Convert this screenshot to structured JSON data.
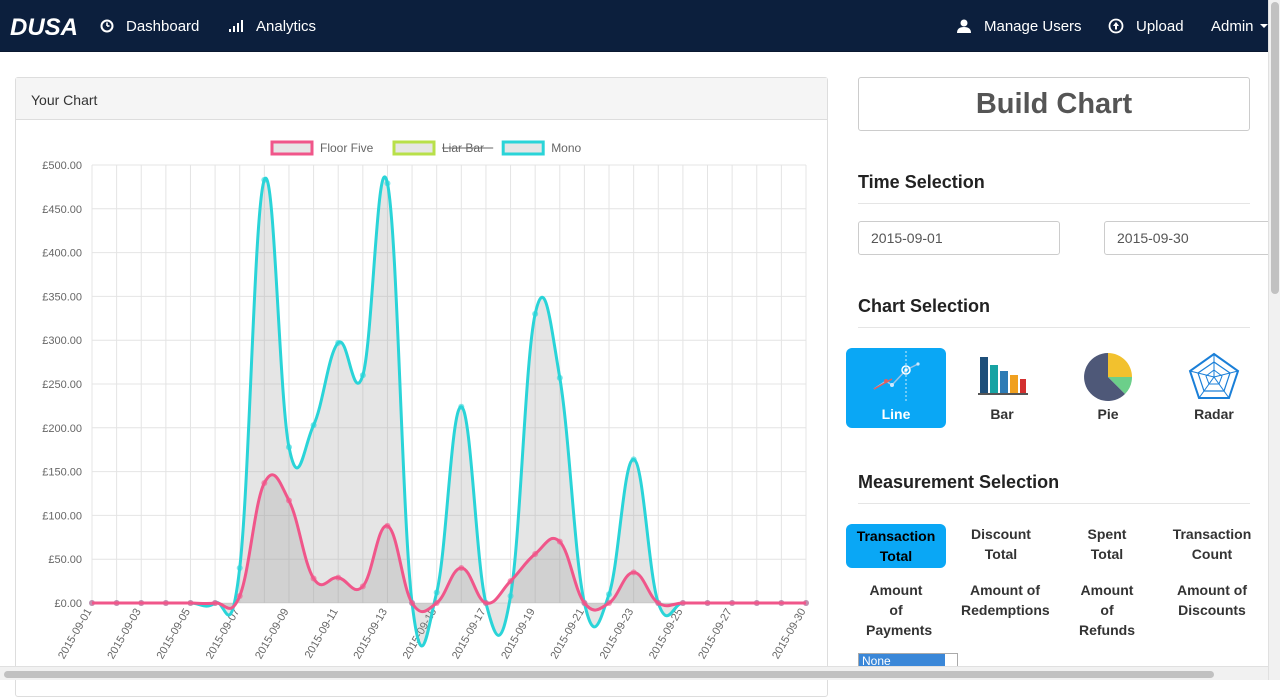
{
  "navbar": {
    "brand": "DUSA",
    "dashboard_label": "Dashboard",
    "analytics_label": "Analytics",
    "manage_users_label": "Manage Users",
    "upload_label": "Upload",
    "admin_label": "Admin",
    "bg_color": "#0c1f3d"
  },
  "panel": {
    "title": "Your Chart"
  },
  "sidebar": {
    "build_button": "Build Chart",
    "time_title": "Time Selection",
    "start_date": "2015-09-01",
    "end_date": "2015-09-30",
    "chart_title": "Chart Selection",
    "chart_types": [
      {
        "label": "Line",
        "icon": "line-chart-icon",
        "active": true
      },
      {
        "label": "Bar",
        "icon": "bar-chart-icon",
        "active": false
      },
      {
        "label": "Pie",
        "icon": "pie-chart-icon",
        "active": false
      },
      {
        "label": "Radar",
        "icon": "radar-chart-icon",
        "active": false
      }
    ],
    "measure_title": "Measurement Selection",
    "measures": {
      "transaction_total": "Transaction Total",
      "discount_total": "Discount Total",
      "spent_total": "Spent Total",
      "transaction_count": "Transaction Count",
      "amount_payments": "Amount of Payments",
      "amount_redemptions": "Amount of Redemptions",
      "amount_refunds": "Amount of Refunds",
      "amount_discounts": "Amount of Discounts"
    },
    "select_value": "None",
    "accent_color": "#0aa7f5"
  },
  "chart_data": {
    "type": "area",
    "title": "",
    "xlabel": "",
    "ylabel": "",
    "ylim": [
      0,
      500
    ],
    "yticks": [
      "£0.00",
      "£50.00",
      "£100.00",
      "£150.00",
      "£200.00",
      "£250.00",
      "£300.00",
      "£350.00",
      "£400.00",
      "£450.00",
      "£500.00"
    ],
    "x": [
      "2015-09-01",
      "2015-09-02",
      "2015-09-03",
      "2015-09-04",
      "2015-09-05",
      "2015-09-06",
      "2015-09-07",
      "2015-09-08",
      "2015-09-09",
      "2015-09-10",
      "2015-09-11",
      "2015-09-12",
      "2015-09-13",
      "2015-09-14",
      "2015-09-15",
      "2015-09-16",
      "2015-09-17",
      "2015-09-18",
      "2015-09-19",
      "2015-09-20",
      "2015-09-21",
      "2015-09-22",
      "2015-09-23",
      "2015-09-24",
      "2015-09-25",
      "2015-09-26",
      "2015-09-27",
      "2015-09-28",
      "2015-09-29",
      "2015-09-30"
    ],
    "xtick_labels": [
      "2015-09-01",
      "2015-09-03",
      "2015-09-05",
      "2015-09-07",
      "2015-09-09",
      "2015-09-11",
      "2015-09-13",
      "2015-09-15",
      "2015-09-17",
      "2015-09-19",
      "2015-09-21",
      "2015-09-23",
      "2015-09-25",
      "2015-09-27",
      "2015-09-30"
    ],
    "series": [
      {
        "name": "Floor Five",
        "color": "#f0568a",
        "hidden": false,
        "values": [
          0,
          0,
          0,
          0,
          0,
          0,
          8,
          137,
          117,
          28,
          29,
          19,
          88,
          0,
          0,
          40,
          0,
          25,
          56,
          70,
          0,
          0,
          35,
          0,
          0,
          0,
          0,
          0,
          0,
          0
        ]
      },
      {
        "name": "Liar Bar",
        "color": "#b8e04a",
        "hidden": true,
        "values": [
          0,
          0,
          0,
          0,
          0,
          0,
          0,
          0,
          0,
          0,
          0,
          0,
          0,
          0,
          0,
          0,
          0,
          0,
          0,
          0,
          0,
          0,
          0,
          0,
          0,
          0,
          0,
          0,
          0,
          0
        ]
      },
      {
        "name": "Mono",
        "color": "#2ad4d8",
        "hidden": false,
        "values": [
          0,
          0,
          0,
          0,
          0,
          0,
          40,
          483,
          178,
          203,
          297,
          260,
          479,
          0,
          12,
          224,
          0,
          8,
          330,
          257,
          0,
          10,
          164,
          0,
          0,
          0,
          0,
          0,
          0,
          0
        ]
      }
    ],
    "legend_position": "top",
    "grid": true
  }
}
